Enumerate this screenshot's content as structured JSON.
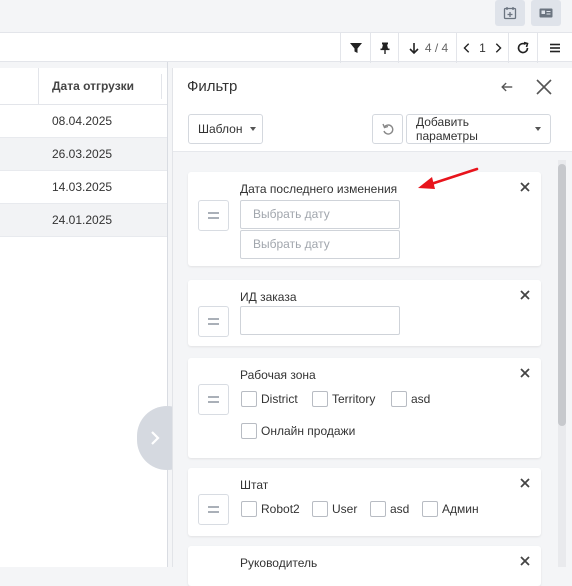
{
  "top_icons": [
    {
      "icon": "calendar-add-icon"
    },
    {
      "icon": "contact-card-icon"
    }
  ],
  "toolbar": {
    "filter_icon": "filter-icon",
    "pin_icon": "pin-icon",
    "sort_icon": "arrow-down-icon",
    "counter": "4 / 4",
    "page_number": "1",
    "refresh_icon": "refresh-icon",
    "menu_icon": "hamburger-menu-icon"
  },
  "table": {
    "column_header": "Дата отгрузки",
    "rows": [
      "08.04.2025",
      "26.03.2025",
      "14.03.2025",
      "24.01.2025"
    ]
  },
  "filter_panel": {
    "title": "Фильтр",
    "template_label": "Шаблон",
    "add_params_label": "Добавить параметры",
    "cards": [
      {
        "title": "Дата последнего изменения",
        "date_from_placeholder": "Выбрать дату",
        "date_to_placeholder": "Выбрать дату"
      },
      {
        "title": "ИД заказа",
        "value": ""
      },
      {
        "title": "Рабочая зона",
        "options": [
          "District",
          "Territory",
          "asd",
          "Онлайн продажи"
        ]
      },
      {
        "title": "Штат",
        "options": [
          "Robot2",
          "User",
          "asd",
          "Админ"
        ]
      },
      {
        "title": "Руководитель"
      }
    ]
  },
  "annotation": {
    "arrow_color": "#e8141c"
  },
  "colors": {
    "accent": "#e8141c",
    "panel_bg": "#f4f5f7",
    "icon_bg": "#dfe3ea"
  }
}
